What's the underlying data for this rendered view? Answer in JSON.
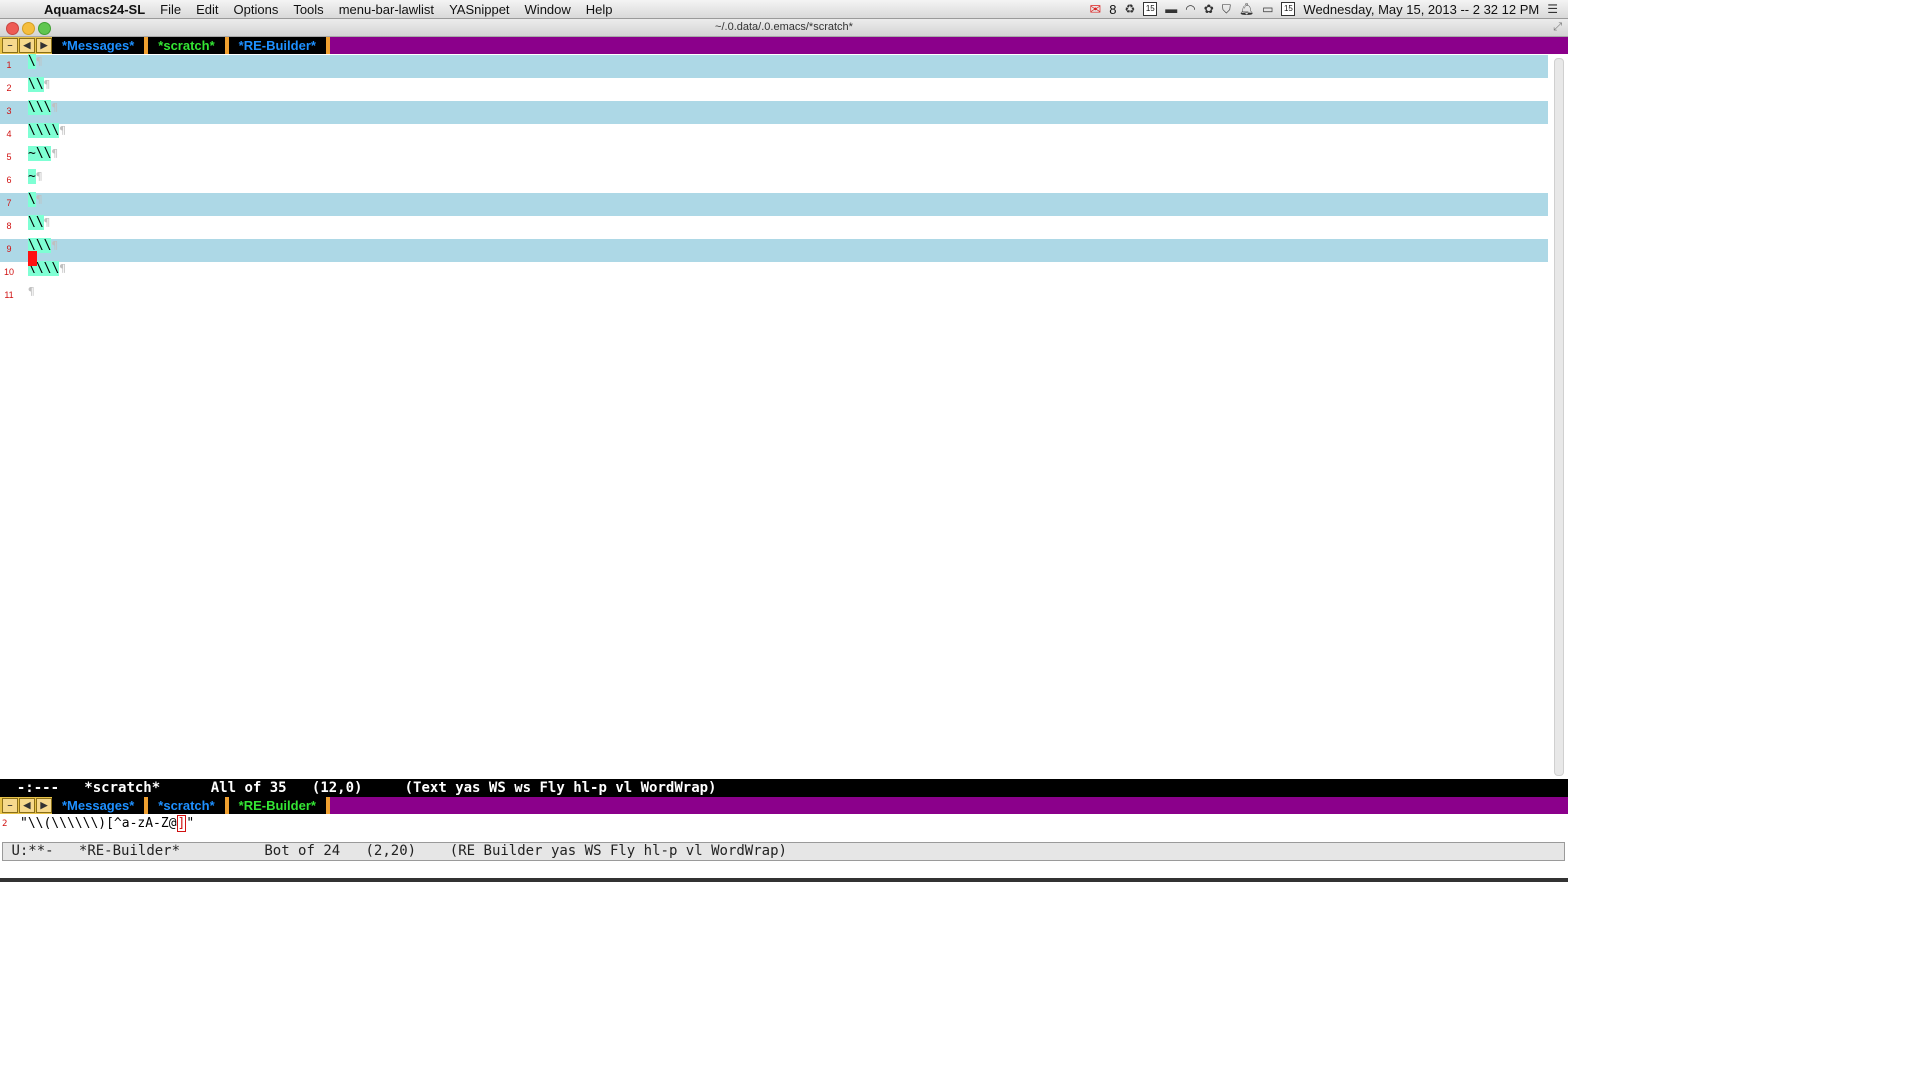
{
  "menubar": {
    "app_name": "Aquamacs24-SL",
    "menus": [
      "File",
      "Edit",
      "Options",
      "Tools",
      "menu-bar-lawlist",
      "YASnippet",
      "Window",
      "Help"
    ],
    "mail_count": "8",
    "calendar_day": "15",
    "calendar_day2": "15",
    "datetime": "Wednesday, May 15, 2013 -- 2 32 12 PM"
  },
  "window": {
    "title": "~/.0.data/.0.emacs/*scratch*"
  },
  "tabbar": {
    "tabs": [
      {
        "label": "*Messages*",
        "color": "#1e90ff"
      },
      {
        "label": "*scratch*",
        "color": "#34e534"
      },
      {
        "label": "*RE-Builder*",
        "color": "#1e90ff"
      }
    ]
  },
  "tabbar2": {
    "tabs": [
      {
        "label": "*Messages*",
        "color": "#1e90ff"
      },
      {
        "label": "*scratch*",
        "color": "#1e90ff"
      },
      {
        "label": "*RE-Builder*",
        "color": "#34e534"
      }
    ]
  },
  "editor": {
    "lines": [
      {
        "num": "1",
        "text": "\\",
        "highlighted": true
      },
      {
        "num": "2",
        "text": "\\\\",
        "highlighted": false
      },
      {
        "num": "3",
        "text": "\\\\\\",
        "highlighted": true
      },
      {
        "num": "4",
        "text": "\\\\\\\\",
        "highlighted": false
      },
      {
        "num": "5",
        "text": "~\\\\",
        "highlighted": false
      },
      {
        "num": "6",
        "text": "~",
        "highlighted": false
      },
      {
        "num": "7",
        "text": "\\",
        "highlighted": true
      },
      {
        "num": "8",
        "text": "\\\\",
        "highlighted": false
      },
      {
        "num": "9",
        "text": "\\\\\\",
        "highlighted": true
      },
      {
        "num": "10",
        "text": "\\\\\\\\",
        "highlighted": false
      },
      {
        "num": "11",
        "text": "",
        "highlighted": false
      }
    ],
    "pilcrow": "¶"
  },
  "modeline1": {
    "status": "-:--- ",
    "buffer": "*scratch*",
    "position": "All of 35",
    "cursor": "(12,0)",
    "modes": "(Text yas WS ws Fly hl-p vl WordWrap)"
  },
  "rebuilder": {
    "line_num": "2",
    "regex_prefix": "\"\\\\(\\\\\\\\\\\\)[^a-zA-Z@",
    "regex_bracket": "]",
    "regex_suffix": "\""
  },
  "modeline2": {
    "status": "U:**-",
    "buffer": "*RE-Builder*",
    "position": "Bot of 24",
    "cursor": "(2,20)",
    "modes": "(RE Builder yas WS Fly hl-p vl WordWrap)"
  },
  "colors": {
    "tabbar_bg": "#8b008b",
    "line_highlight": "#add8e6",
    "match_highlight": "#7fffd4",
    "cursor": "#ff1010",
    "line_number": "#d01010"
  }
}
